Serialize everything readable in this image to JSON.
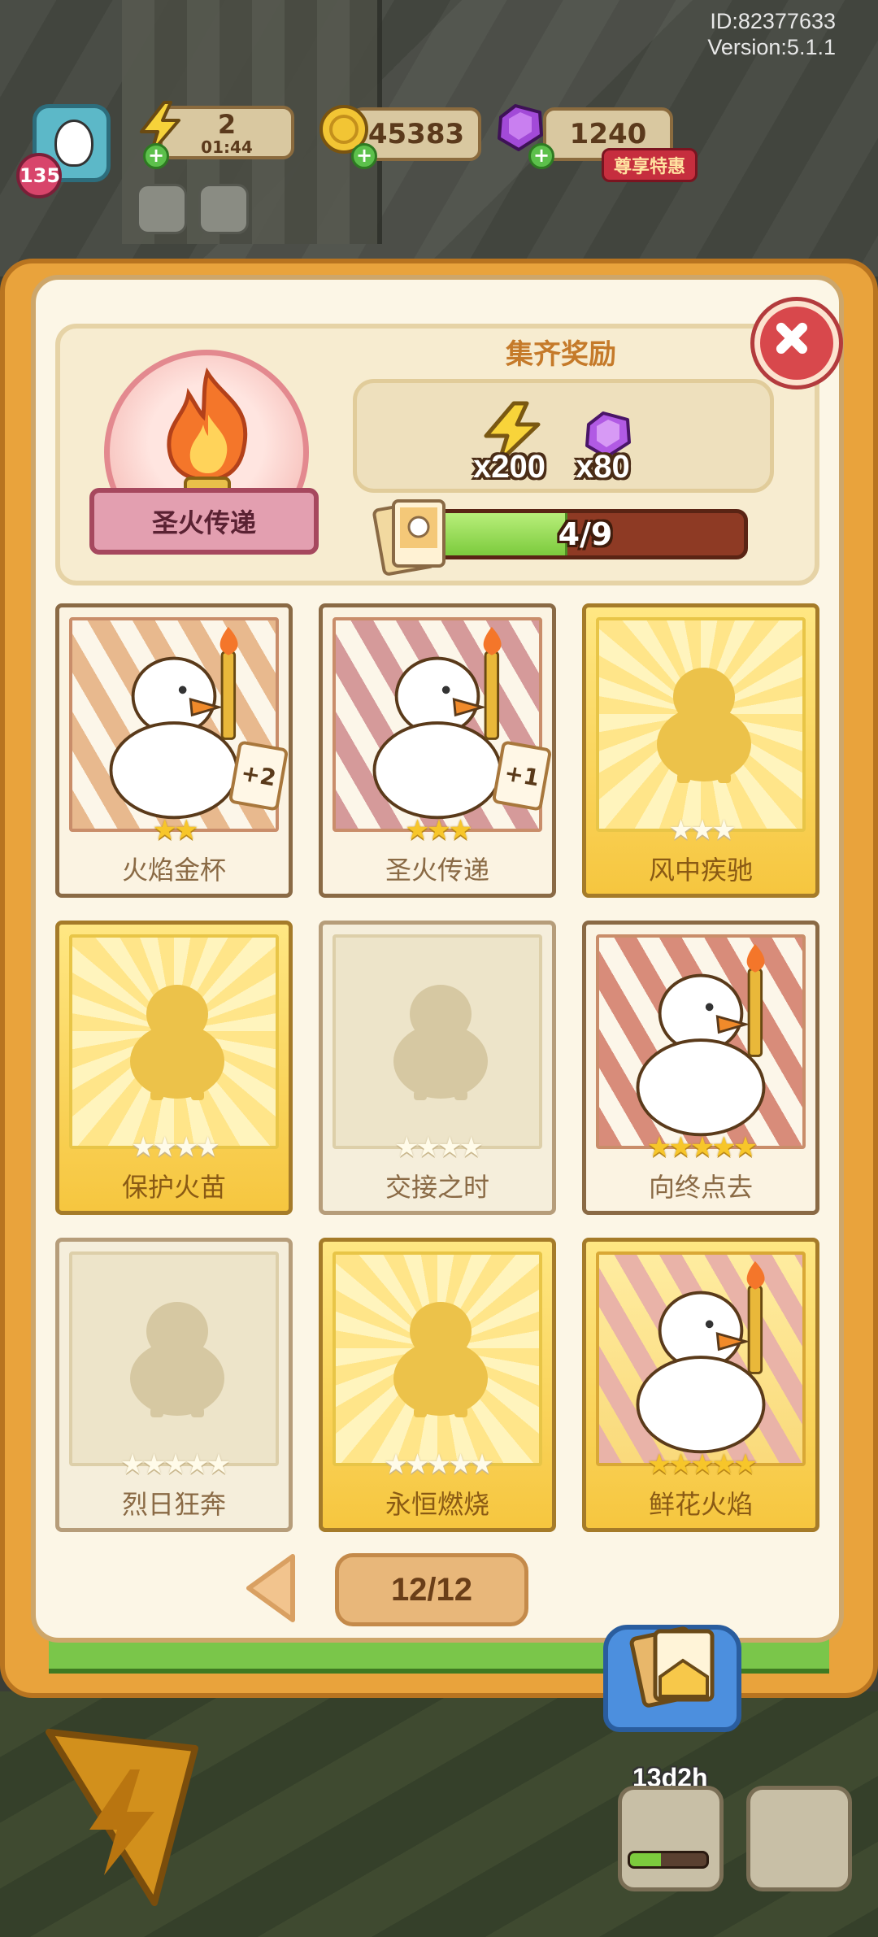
{
  "meta": {
    "id_label": "ID:82377633",
    "version_label": "Version:5.1.1"
  },
  "hud": {
    "level": "135",
    "energy": {
      "value": "2",
      "timer": "01:44"
    },
    "coins": "45383",
    "gems": "1240",
    "vip_offer": "尊享特惠"
  },
  "collection": {
    "badge_title": "圣火传递",
    "reward_title": "集齐奖励",
    "rewards": [
      {
        "icon": "lightning-icon",
        "amount": "x200"
      },
      {
        "icon": "gem-icon",
        "amount": "x80"
      }
    ],
    "progress_text": "4/9",
    "progress_fraction": 0.444
  },
  "cards": [
    {
      "name": "火焰金杯",
      "stars": 2,
      "max_stars": 2,
      "state": "owned",
      "dup": "+2"
    },
    {
      "name": "圣火传递",
      "stars": 3,
      "max_stars": 3,
      "state": "owned",
      "dup": "+1"
    },
    {
      "name": "风中疾驰",
      "stars": 0,
      "max_stars": 3,
      "state": "rare-locked",
      "dup": ""
    },
    {
      "name": "保护火苗",
      "stars": 0,
      "max_stars": 4,
      "state": "rare-locked",
      "dup": ""
    },
    {
      "name": "交接之时",
      "stars": 0,
      "max_stars": 4,
      "state": "locked",
      "dup": ""
    },
    {
      "name": "向终点去",
      "stars": 5,
      "max_stars": 5,
      "state": "owned",
      "dup": ""
    },
    {
      "name": "烈日狂奔",
      "stars": 0,
      "max_stars": 5,
      "state": "locked",
      "dup": ""
    },
    {
      "name": "永恒燃烧",
      "stars": 0,
      "max_stars": 5,
      "state": "rare-locked",
      "dup": ""
    },
    {
      "name": "鲜花火焰",
      "stars": 5,
      "max_stars": 5,
      "state": "rare-owned",
      "dup": ""
    }
  ],
  "pagination": {
    "label": "12/12"
  },
  "bottom": {
    "timer": "13d2h"
  },
  "colors": {
    "accent_orange": "#e9a33c",
    "progress_green": "#7ccb3d",
    "close_red": "#d8484c",
    "star_gold": "#f7c62a"
  }
}
